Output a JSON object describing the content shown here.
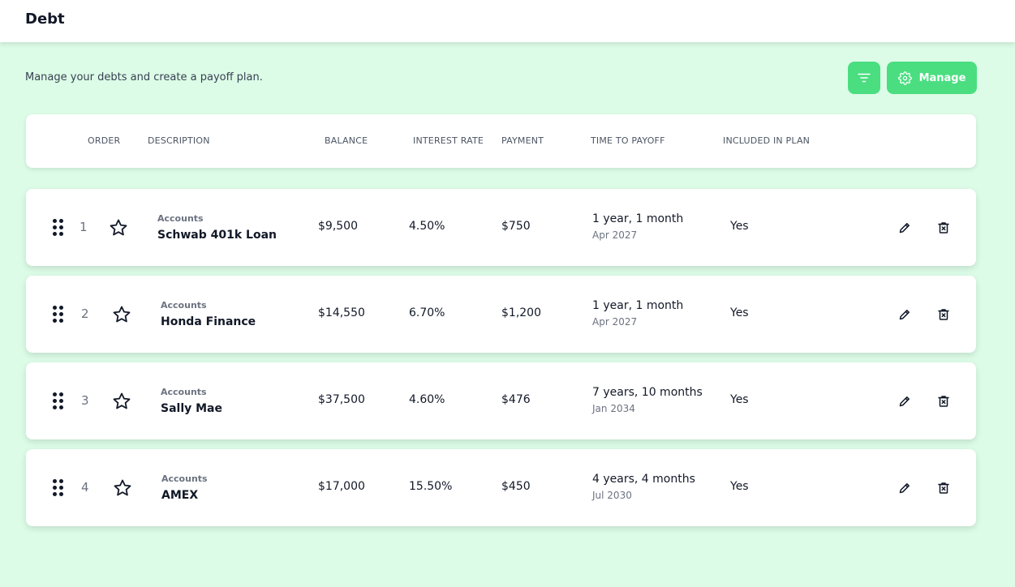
{
  "header": {
    "title": "Debt"
  },
  "intro": {
    "text": "Manage your debts and create a payoff plan."
  },
  "toolbar": {
    "filter_icon": "filter-icon",
    "manage_icon": "gear-icon",
    "manage_label": "Manage",
    "accent_color": "#4ade80"
  },
  "table": {
    "columns": {
      "order": "ORDER",
      "description": "DESCRIPTION",
      "balance": "BALANCE",
      "interest_rate": "INTEREST RATE",
      "payment": "PAYMENT",
      "time_to_payoff": "TIME TO PAYOFF",
      "included_in_plan": "INCLUDED IN PLAN"
    },
    "rows": [
      {
        "order": "1",
        "category": "Accounts",
        "name": "Schwab 401k Loan",
        "balance": "$9,500",
        "interest_rate": "4.50%",
        "payment": "$750",
        "payoff_time": "1 year, 1 month",
        "payoff_date": "Apr 2027",
        "included": "Yes"
      },
      {
        "order": "2",
        "category": "Accounts",
        "name": "Honda Finance",
        "balance": "$14,550",
        "interest_rate": "6.70%",
        "payment": "$1,200",
        "payoff_time": "1 year, 1 month",
        "payoff_date": "Apr 2027",
        "included": "Yes"
      },
      {
        "order": "3",
        "category": "Accounts",
        "name": "Sally Mae",
        "balance": "$37,500",
        "interest_rate": "4.60%",
        "payment": "$476",
        "payoff_time": "7 years, 10 months",
        "payoff_date": "Jan 2034",
        "included": "Yes"
      },
      {
        "order": "4",
        "category": "Accounts",
        "name": "AMEX",
        "balance": "$17,000",
        "interest_rate": "15.50%",
        "payment": "$450",
        "payoff_time": "4 years, 4 months",
        "payoff_date": "Jul 2030",
        "included": "Yes"
      }
    ]
  }
}
